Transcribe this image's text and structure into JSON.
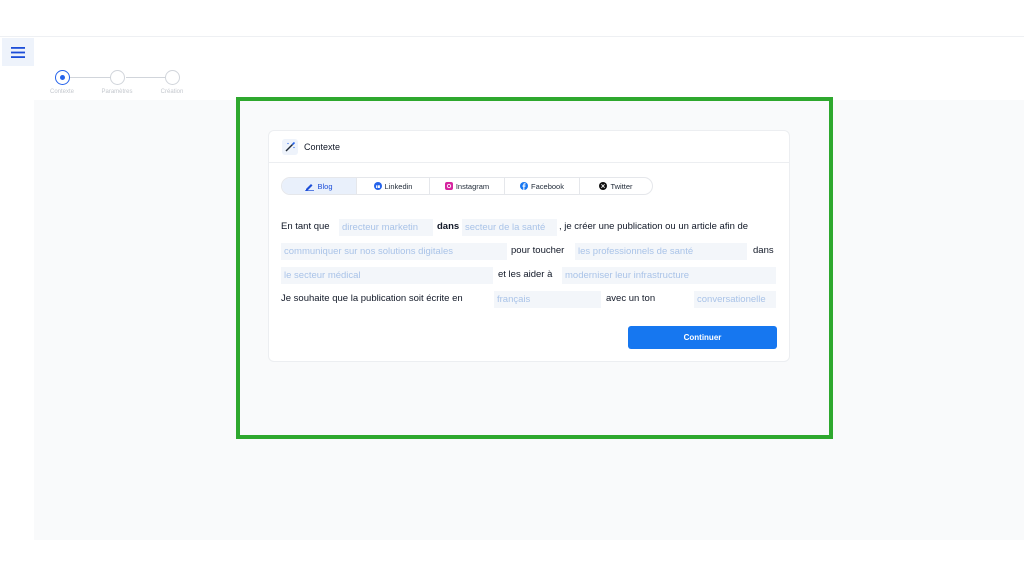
{
  "stepper": {
    "steps": [
      {
        "label": "Contexte",
        "active": true
      },
      {
        "label": "Paramètres",
        "active": false
      },
      {
        "label": "Création",
        "active": false
      }
    ]
  },
  "card": {
    "title": "Contexte",
    "tabs": [
      {
        "label": "Blog",
        "icon": "pen-icon",
        "active": true
      },
      {
        "label": "Linkedin",
        "icon": "linkedin-icon",
        "active": false
      },
      {
        "label": "Instagram",
        "icon": "instagram-icon",
        "active": false
      },
      {
        "label": "Facebook",
        "icon": "facebook-icon",
        "active": false
      },
      {
        "label": "Twitter",
        "icon": "x-icon",
        "active": false
      }
    ],
    "form": {
      "text_1": "En tant que",
      "field_role": "directeur marketin",
      "text_2": "dans",
      "field_sector": "secteur de la santé",
      "text_3": ", je créer une publication ou un article afin de",
      "field_goal": "communiquer sur nos solutions digitales",
      "text_4": "pour toucher",
      "field_audience": "les professionnels de santé",
      "text_5": "dans",
      "field_domain": "le secteur médical",
      "text_6": "et les aider à",
      "field_benefit": "moderniser leur infrastructure",
      "text_7": "Je souhaite que la publication soit écrite en",
      "field_language": "français",
      "text_8": "avec un ton",
      "field_tone": "conversationelle"
    },
    "continue_label": "Continuer"
  },
  "colors": {
    "accent": "#1677f0",
    "highlight_border": "#2ea82e",
    "placeholder": "#a9c3e8"
  }
}
